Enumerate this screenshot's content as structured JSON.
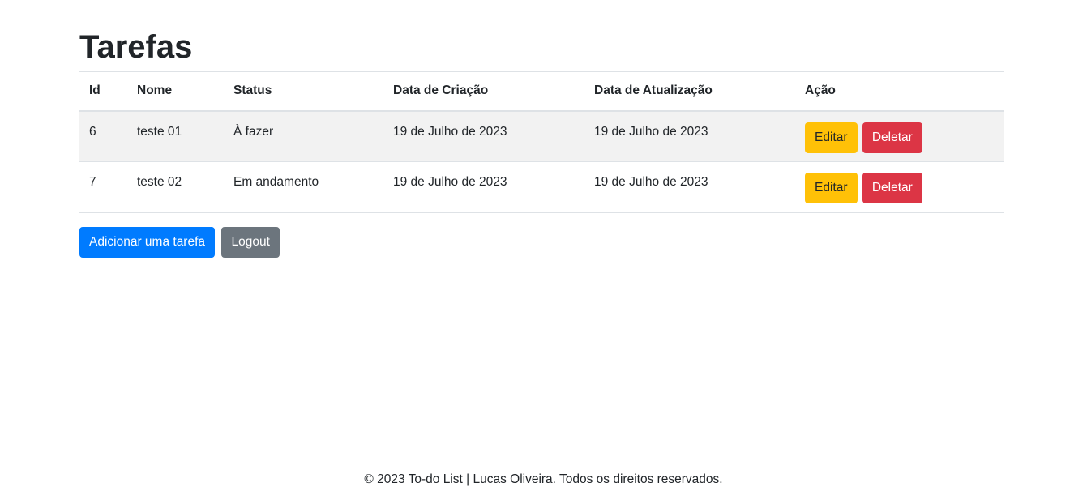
{
  "page": {
    "title": "Tarefas"
  },
  "table": {
    "headers": [
      "Id",
      "Nome",
      "Status",
      "Data de Criação",
      "Data de Atualização",
      "Ação"
    ],
    "rows": [
      {
        "id": "6",
        "nome": "teste 01",
        "status": "À fazer",
        "criacao": "19 de Julho de 2023",
        "atualizacao": "19 de Julho de 2023",
        "edit_label": "Editar",
        "delete_label": "Deletar"
      },
      {
        "id": "7",
        "nome": "teste 02",
        "status": "Em andamento",
        "criacao": "19 de Julho de 2023",
        "atualizacao": "19 de Julho de 2023",
        "edit_label": "Editar",
        "delete_label": "Deletar"
      }
    ]
  },
  "actions": {
    "add_label": "Adicionar uma tarefa",
    "logout_label": "Logout"
  },
  "footer": {
    "text": "© 2023 To-do List | Lucas Oliveira. Todos os direitos reservados."
  },
  "colors": {
    "primary": "#007bff",
    "secondary": "#6c757d",
    "warning": "#ffc107",
    "danger": "#dc3545",
    "stripe": "#f2f2f2"
  }
}
